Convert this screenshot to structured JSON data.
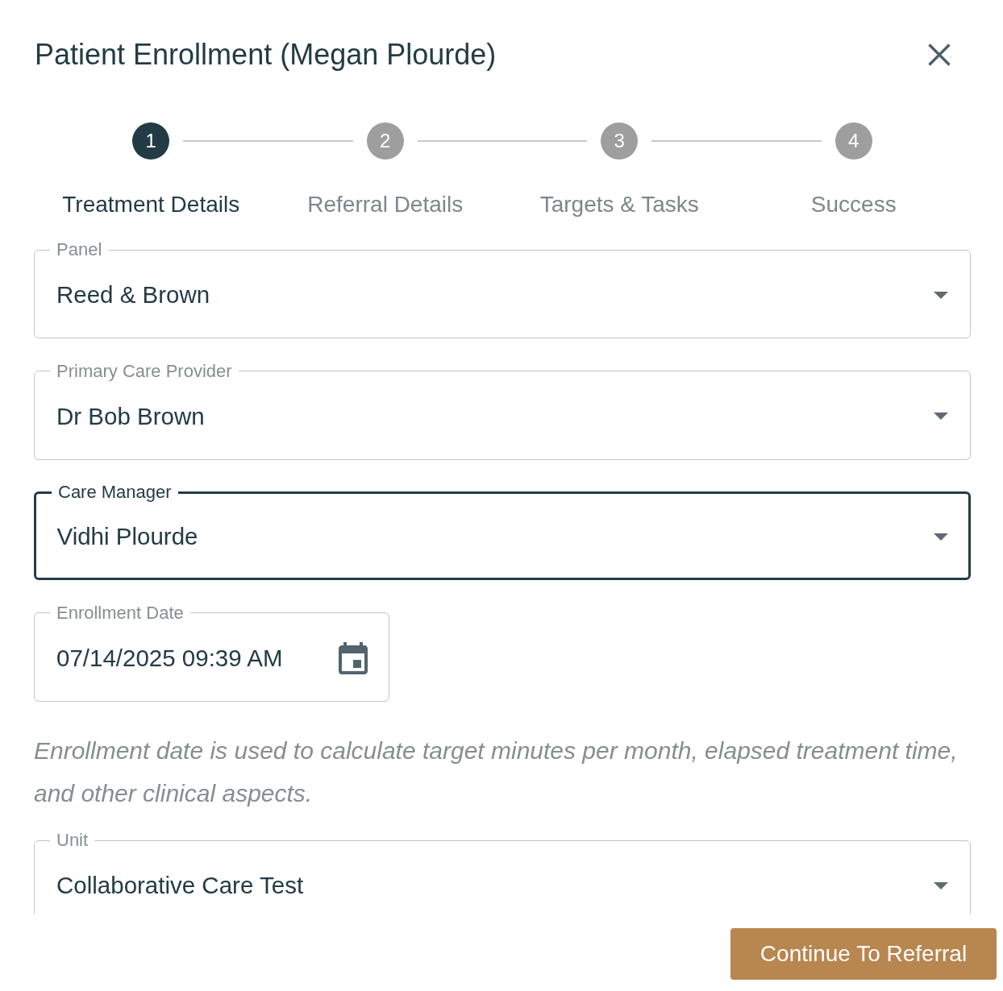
{
  "dialog": {
    "title": "Patient Enrollment (Megan Plourde)"
  },
  "stepper": {
    "steps": [
      {
        "number": "1",
        "label": "Treatment Details",
        "selected": true
      },
      {
        "number": "2",
        "label": "Referral Details",
        "selected": false
      },
      {
        "number": "3",
        "label": "Targets & Tasks",
        "selected": false
      },
      {
        "number": "4",
        "label": "Success",
        "selected": false
      }
    ]
  },
  "form": {
    "fields": [
      {
        "kind": "select",
        "label": "Panel",
        "value": "Reed & Brown",
        "focused": false
      },
      {
        "kind": "select",
        "label": "Primary Care Provider",
        "value": "Dr Bob Brown",
        "focused": false
      },
      {
        "kind": "select",
        "label": "Care Manager",
        "value": "Vidhi Plourde",
        "focused": true
      },
      {
        "kind": "date",
        "label": "Enrollment Date",
        "value": "07/14/2025 09:39 AM",
        "focused": false,
        "helper": "Enrollment date is used to calculate target minutes per month, elapsed treatment time, and other clinical aspects."
      },
      {
        "kind": "select",
        "label": "Unit",
        "value": "Collaborative Care Test",
        "focused": false
      }
    ]
  },
  "footer": {
    "primary_button": "Continue To Referral"
  }
}
